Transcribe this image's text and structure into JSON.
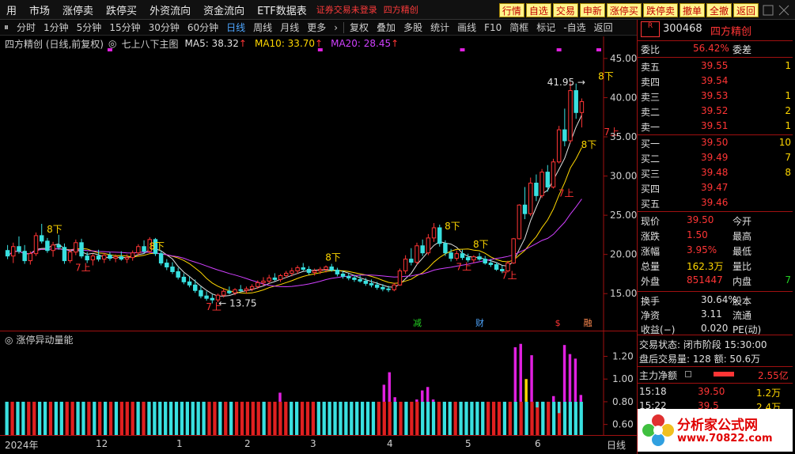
{
  "menu": {
    "items": [
      "用",
      "市场",
      "涨停卖",
      "跌停买",
      "外资流向",
      "资金流向",
      "ETF数据表"
    ],
    "warning": "证券交易未登录",
    "stock_name_tag": "四方精创",
    "quick_buttons": [
      "行情",
      "自选",
      "交易",
      "申新",
      "涨停买",
      "跌停卖",
      "撤单",
      "全撤"
    ],
    "back_label": "返回"
  },
  "toolbar": {
    "periods": [
      "分时",
      "1分钟",
      "5分钟",
      "15分钟",
      "30分钟",
      "60分钟",
      "日线",
      "周线",
      "月线",
      "更多"
    ],
    "active_period": "日线",
    "actions": [
      "复权",
      "叠加",
      "多股",
      "统计",
      "画线",
      "F10",
      "简框",
      "标记",
      "-自选",
      "返回"
    ]
  },
  "chart_header": {
    "title": "四方精创 (日线,前复权)",
    "indicator": "七上八下主图",
    "ma5": "MA5: 38.32",
    "ma10": "MA10: 33.70",
    "ma20": "MA20: 28.45",
    "ma5_color": "#e0e0e0",
    "ma10_color": "#ffd700",
    "ma20_color": "#d040ff"
  },
  "chart_data": [
    {
      "type": "candlestick",
      "title": "四方精创 (日线,前复权)",
      "ylim": [
        12.5,
        46
      ],
      "y_ticks": [
        15.0,
        20.0,
        25.0,
        30.0,
        35.0,
        40.0,
        45.0
      ],
      "x_labels": [
        "2024年",
        "12",
        "1",
        "2",
        "3",
        "4",
        "5",
        "6"
      ],
      "candles": [
        {
          "o": 20.5,
          "h": 21.2,
          "l": 19.4,
          "c": 19.8
        },
        {
          "o": 19.8,
          "h": 21.5,
          "l": 18.9,
          "c": 21.0
        },
        {
          "o": 21.0,
          "h": 22.3,
          "l": 20.1,
          "c": 20.4
        },
        {
          "o": 20.4,
          "h": 21.2,
          "l": 18.8,
          "c": 19.2
        },
        {
          "o": 19.2,
          "h": 20.4,
          "l": 18.7,
          "c": 20.1
        },
        {
          "o": 20.1,
          "h": 22.8,
          "l": 19.8,
          "c": 22.4
        },
        {
          "o": 22.4,
          "h": 23.9,
          "l": 21.4,
          "c": 21.7
        },
        {
          "o": 21.7,
          "h": 22.1,
          "l": 20.2,
          "c": 20.5
        },
        {
          "o": 20.5,
          "h": 21.6,
          "l": 19.7,
          "c": 21.2
        },
        {
          "o": 21.2,
          "h": 22.5,
          "l": 20.6,
          "c": 20.9
        },
        {
          "o": 20.9,
          "h": 21.4,
          "l": 18.8,
          "c": 19.2
        },
        {
          "o": 19.2,
          "h": 20.6,
          "l": 18.9,
          "c": 20.3
        },
        {
          "o": 20.3,
          "h": 21.9,
          "l": 19.9,
          "c": 21.5
        },
        {
          "o": 21.5,
          "h": 22.0,
          "l": 19.5,
          "c": 19.8
        },
        {
          "o": 19.8,
          "h": 20.3,
          "l": 18.9,
          "c": 19.3
        },
        {
          "o": 19.3,
          "h": 20.1,
          "l": 18.6,
          "c": 19.8
        },
        {
          "o": 19.8,
          "h": 20.6,
          "l": 19.1,
          "c": 19.4
        },
        {
          "o": 19.4,
          "h": 20.2,
          "l": 18.9,
          "c": 19.9
        },
        {
          "o": 19.9,
          "h": 20.3,
          "l": 19.2,
          "c": 19.5
        },
        {
          "o": 19.5,
          "h": 20.0,
          "l": 19.0,
          "c": 19.7
        },
        {
          "o": 19.7,
          "h": 20.4,
          "l": 19.2,
          "c": 19.4
        },
        {
          "o": 19.4,
          "h": 20.0,
          "l": 18.9,
          "c": 19.6
        },
        {
          "o": 19.6,
          "h": 20.5,
          "l": 19.2,
          "c": 20.2
        },
        {
          "o": 20.2,
          "h": 21.3,
          "l": 19.8,
          "c": 21.0
        },
        {
          "o": 21.0,
          "h": 21.8,
          "l": 20.1,
          "c": 20.4
        },
        {
          "o": 20.4,
          "h": 22.2,
          "l": 20.2,
          "c": 21.9
        },
        {
          "o": 21.9,
          "h": 22.1,
          "l": 19.8,
          "c": 20.1
        },
        {
          "o": 20.1,
          "h": 20.5,
          "l": 18.6,
          "c": 18.9
        },
        {
          "o": 18.9,
          "h": 19.4,
          "l": 18.0,
          "c": 18.4
        },
        {
          "o": 18.4,
          "h": 19.0,
          "l": 17.5,
          "c": 17.8
        },
        {
          "o": 17.8,
          "h": 18.3,
          "l": 16.8,
          "c": 17.1
        },
        {
          "o": 17.1,
          "h": 17.6,
          "l": 16.2,
          "c": 16.5
        },
        {
          "o": 16.5,
          "h": 17.2,
          "l": 15.8,
          "c": 16.1
        },
        {
          "o": 16.1,
          "h": 16.8,
          "l": 15.1,
          "c": 15.4
        },
        {
          "o": 15.4,
          "h": 15.9,
          "l": 14.4,
          "c": 14.7
        },
        {
          "o": 14.7,
          "h": 15.3,
          "l": 14.1,
          "c": 14.4
        },
        {
          "o": 14.4,
          "h": 14.9,
          "l": 13.75,
          "c": 14.2
        },
        {
          "o": 14.2,
          "h": 15.0,
          "l": 13.9,
          "c": 14.8
        },
        {
          "o": 14.8,
          "h": 15.6,
          "l": 14.5,
          "c": 15.3
        },
        {
          "o": 15.3,
          "h": 15.9,
          "l": 14.9,
          "c": 15.1
        },
        {
          "o": 15.1,
          "h": 15.7,
          "l": 14.8,
          "c": 15.5
        },
        {
          "o": 15.5,
          "h": 16.1,
          "l": 15.2,
          "c": 15.4
        },
        {
          "o": 15.4,
          "h": 15.9,
          "l": 15.0,
          "c": 15.6
        },
        {
          "o": 15.6,
          "h": 16.2,
          "l": 15.3,
          "c": 15.9
        },
        {
          "o": 15.9,
          "h": 16.7,
          "l": 15.6,
          "c": 16.4
        },
        {
          "o": 16.4,
          "h": 17.1,
          "l": 16.0,
          "c": 16.6
        },
        {
          "o": 16.6,
          "h": 17.4,
          "l": 16.3,
          "c": 17.0
        },
        {
          "o": 17.0,
          "h": 17.6,
          "l": 16.6,
          "c": 16.8
        },
        {
          "o": 16.8,
          "h": 17.5,
          "l": 16.5,
          "c": 17.3
        },
        {
          "o": 17.3,
          "h": 17.9,
          "l": 17.0,
          "c": 17.6
        },
        {
          "o": 17.6,
          "h": 18.3,
          "l": 17.2,
          "c": 17.9
        },
        {
          "o": 17.9,
          "h": 18.6,
          "l": 17.5,
          "c": 18.3
        },
        {
          "o": 18.3,
          "h": 18.9,
          "l": 17.9,
          "c": 18.1
        },
        {
          "o": 18.1,
          "h": 18.5,
          "l": 17.4,
          "c": 17.7
        },
        {
          "o": 17.7,
          "h": 18.2,
          "l": 17.3,
          "c": 17.9
        },
        {
          "o": 17.9,
          "h": 18.4,
          "l": 17.5,
          "c": 18.1
        },
        {
          "o": 18.1,
          "h": 18.6,
          "l": 17.7,
          "c": 18.4
        },
        {
          "o": 18.4,
          "h": 18.8,
          "l": 17.8,
          "c": 18.0
        },
        {
          "o": 18.0,
          "h": 18.3,
          "l": 17.2,
          "c": 17.5
        },
        {
          "o": 17.5,
          "h": 17.9,
          "l": 16.9,
          "c": 17.2
        },
        {
          "o": 17.2,
          "h": 17.6,
          "l": 16.7,
          "c": 17.0
        },
        {
          "o": 17.0,
          "h": 17.4,
          "l": 16.5,
          "c": 16.8
        },
        {
          "o": 16.8,
          "h": 17.3,
          "l": 16.4,
          "c": 16.6
        },
        {
          "o": 16.6,
          "h": 17.0,
          "l": 16.0,
          "c": 16.3
        },
        {
          "o": 16.3,
          "h": 16.8,
          "l": 15.8,
          "c": 16.1
        },
        {
          "o": 16.1,
          "h": 16.5,
          "l": 15.5,
          "c": 15.8
        },
        {
          "o": 15.8,
          "h": 16.2,
          "l": 15.3,
          "c": 15.6
        },
        {
          "o": 15.6,
          "h": 16.0,
          "l": 15.2,
          "c": 15.5
        },
        {
          "o": 15.5,
          "h": 16.4,
          "l": 15.3,
          "c": 16.1
        },
        {
          "o": 16.1,
          "h": 18.2,
          "l": 16.0,
          "c": 17.9
        },
        {
          "o": 17.9,
          "h": 19.9,
          "l": 17.5,
          "c": 19.4
        },
        {
          "o": 19.4,
          "h": 20.8,
          "l": 18.6,
          "c": 19.0
        },
        {
          "o": 19.0,
          "h": 21.5,
          "l": 18.7,
          "c": 21.1
        },
        {
          "o": 21.1,
          "h": 21.9,
          "l": 19.8,
          "c": 20.2
        },
        {
          "o": 20.2,
          "h": 22.6,
          "l": 19.9,
          "c": 22.1
        },
        {
          "o": 22.1,
          "h": 24.0,
          "l": 21.6,
          "c": 23.4
        },
        {
          "o": 23.4,
          "h": 23.8,
          "l": 21.0,
          "c": 21.4
        },
        {
          "o": 21.4,
          "h": 21.8,
          "l": 19.8,
          "c": 20.2
        },
        {
          "o": 20.2,
          "h": 20.7,
          "l": 19.1,
          "c": 19.5
        },
        {
          "o": 19.5,
          "h": 20.5,
          "l": 19.2,
          "c": 20.1
        },
        {
          "o": 20.1,
          "h": 20.6,
          "l": 19.3,
          "c": 19.6
        },
        {
          "o": 19.6,
          "h": 20.1,
          "l": 19.0,
          "c": 19.3
        },
        {
          "o": 19.3,
          "h": 19.9,
          "l": 18.9,
          "c": 19.7
        },
        {
          "o": 19.7,
          "h": 20.2,
          "l": 19.2,
          "c": 19.4
        },
        {
          "o": 19.4,
          "h": 19.8,
          "l": 18.7,
          "c": 18.9
        },
        {
          "o": 18.9,
          "h": 19.4,
          "l": 18.4,
          "c": 18.7
        },
        {
          "o": 18.7,
          "h": 19.0,
          "l": 17.9,
          "c": 18.1
        },
        {
          "o": 18.1,
          "h": 18.6,
          "l": 17.6,
          "c": 17.9
        },
        {
          "o": 17.9,
          "h": 19.2,
          "l": 17.7,
          "c": 18.9
        },
        {
          "o": 18.9,
          "h": 22.1,
          "l": 18.8,
          "c": 22.0
        },
        {
          "o": 22.0,
          "h": 26.4,
          "l": 21.9,
          "c": 26.3
        },
        {
          "o": 26.3,
          "h": 28.6,
          "l": 24.5,
          "c": 25.2
        },
        {
          "o": 25.2,
          "h": 29.8,
          "l": 24.9,
          "c": 29.1
        },
        {
          "o": 29.1,
          "h": 30.2,
          "l": 26.8,
          "c": 27.5
        },
        {
          "o": 27.5,
          "h": 30.9,
          "l": 27.2,
          "c": 30.5
        },
        {
          "o": 30.5,
          "h": 31.4,
          "l": 28.0,
          "c": 28.6
        },
        {
          "o": 28.6,
          "h": 32.2,
          "l": 28.4,
          "c": 31.8
        },
        {
          "o": 31.8,
          "h": 36.4,
          "l": 31.6,
          "c": 35.9
        },
        {
          "o": 35.9,
          "h": 38.6,
          "l": 33.8,
          "c": 34.5
        },
        {
          "o": 34.5,
          "h": 41.95,
          "l": 34.2,
          "c": 40.9
        },
        {
          "o": 40.9,
          "h": 41.8,
          "l": 37.3,
          "c": 38.1
        },
        {
          "o": 38.1,
          "h": 39.9,
          "l": 36.2,
          "c": 39.5
        }
      ],
      "annotations": [
        {
          "text": "8下",
          "x": 8,
          "y": 22.8,
          "color": "#ffd700"
        },
        {
          "text": "7上",
          "x": 13,
          "y": 17.9,
          "color": "#ff3535"
        },
        {
          "text": "8下",
          "x": 26,
          "y": 20.6,
          "color": "#ffd700"
        },
        {
          "text": "7上",
          "x": 36,
          "y": 12.9,
          "color": "#ff3535"
        },
        {
          "text": "8下",
          "x": 57,
          "y": 19.2,
          "color": "#ffd700"
        },
        {
          "text": "8下",
          "x": 78,
          "y": 23.2,
          "color": "#ffd700"
        },
        {
          "text": "8下",
          "x": 83,
          "y": 20.9,
          "color": "#ffd700"
        },
        {
          "text": "7上",
          "x": 80,
          "y": 18.0,
          "color": "#ff3535"
        },
        {
          "text": "7上",
          "x": 88,
          "y": 16.9,
          "color": "#ff3535"
        },
        {
          "text": "7上",
          "x": 98,
          "y": 27.4,
          "color": "#ff3535"
        },
        {
          "text": "8下",
          "x": 102,
          "y": 33.6,
          "color": "#ffd700"
        },
        {
          "text": "8下",
          "x": 105,
          "y": 42.3,
          "color": "#ffd700"
        },
        {
          "text": "7上",
          "x": 106,
          "y": 35.2,
          "color": "#ff3535"
        }
      ],
      "price_labels": [
        {
          "text": "41.95",
          "x": 103,
          "y": 41.95
        },
        {
          "text": "13.75",
          "x": 36,
          "y": 13.75
        }
      ],
      "event_tags": [
        {
          "text": "减",
          "x": 72,
          "color": "#22d022"
        },
        {
          "text": "财",
          "x": 83,
          "color": "#4ea6ff"
        },
        {
          "text": "$",
          "x": 97,
          "color": "#ff3535"
        },
        {
          "text": "融",
          "x": 102,
          "color": "#ff8a50"
        }
      ],
      "magenta_marks_x": [
        18,
        55,
        80,
        97,
        104
      ]
    },
    {
      "type": "bar",
      "title": "涨停异动量能",
      "ylim": [
        0.5,
        1.35
      ],
      "y_ticks": [
        0.6,
        0.8,
        1.0,
        1.2
      ],
      "note": "bars below 0.8 = base bars (red/cyan); above = magenta signal bars",
      "values": [
        0.8,
        0.8,
        0.8,
        0.8,
        0.8,
        0.8,
        0.8,
        0.8,
        0.8,
        0.8,
        0.8,
        0.8,
        0.8,
        0.8,
        0.8,
        0.8,
        0.8,
        0.8,
        0.8,
        0.8,
        0.8,
        0.8,
        0.8,
        0.8,
        0.8,
        0.8,
        0.8,
        0.8,
        0.8,
        0.8,
        0.8,
        0.8,
        0.8,
        0.8,
        0.8,
        0.8,
        0.8,
        0.8,
        0.8,
        0.8,
        0.8,
        0.8,
        0.8,
        0.8,
        0.8,
        0.8,
        0.8,
        0.8,
        0.8,
        0.8,
        0.88,
        0.8,
        0.8,
        0.8,
        0.8,
        0.8,
        0.8,
        0.8,
        0.8,
        0.8,
        0.8,
        0.8,
        0.8,
        0.8,
        0.8,
        0.8,
        0.8,
        0.8,
        0.8,
        0.95,
        1.06,
        0.84,
        0.8,
        0.8,
        0.8,
        0.82,
        0.9,
        0.93,
        0.82,
        0.8,
        0.8,
        0.8,
        0.8,
        0.8,
        0.8,
        0.8,
        0.8,
        0.8,
        0.8,
        0.8,
        0.8,
        0.8,
        0.8,
        1.28,
        1.31,
        1.0,
        1.21,
        0.75,
        0.74,
        0.8,
        0.85,
        0.7,
        1.3,
        1.22,
        1.18,
        0.86
      ],
      "signal_color": "#e020e0",
      "yellow_index": 95
    }
  ],
  "volume_panel": {
    "title": "涨停异动量能"
  },
  "x_axis": {
    "labels": [
      "2024年",
      "12",
      "1",
      "2",
      "3",
      "4",
      "5",
      "6"
    ],
    "right_label": "日线"
  },
  "right_panel": {
    "code": "300468",
    "name": "四方精创",
    "market_icon": "R",
    "weibi_label": "委比",
    "weibi_value": "56.42%",
    "weicha_label": "委差",
    "asks": [
      {
        "label": "卖五",
        "price": "39.55",
        "vol": "1"
      },
      {
        "label": "卖四",
        "price": "39.54",
        "vol": ""
      },
      {
        "label": "卖三",
        "price": "39.53",
        "vol": "1"
      },
      {
        "label": "卖二",
        "price": "39.52",
        "vol": "2"
      },
      {
        "label": "卖一",
        "price": "39.51",
        "vol": "1"
      }
    ],
    "bids": [
      {
        "label": "买一",
        "price": "39.50",
        "vol": "10"
      },
      {
        "label": "买二",
        "price": "39.49",
        "vol": "7"
      },
      {
        "label": "买三",
        "price": "39.48",
        "vol": "8"
      },
      {
        "label": "买四",
        "price": "39.47",
        "vol": ""
      },
      {
        "label": "买五",
        "price": "39.46",
        "vol": ""
      }
    ],
    "quote": [
      {
        "l1": "现价",
        "v1": "39.50",
        "l2": "今开",
        "v2": "",
        "c1": "red"
      },
      {
        "l1": "涨跌",
        "v1": "1.50",
        "l2": "最高",
        "v2": "",
        "c1": "red"
      },
      {
        "l1": "涨幅",
        "v1": "3.95%",
        "l2": "最低",
        "v2": "",
        "c1": "red"
      },
      {
        "l1": "总量",
        "v1": "162.3万",
        "l2": "量比",
        "v2": "",
        "c1": "yellow"
      },
      {
        "l1": "外盘",
        "v1": "851447",
        "l2": "内盘",
        "v2": "7",
        "c1": "red"
      }
    ],
    "stats": [
      {
        "l1": "换手",
        "v1": "30.64%",
        "l2": "股本"
      },
      {
        "l1": "净资",
        "v1": "3.11",
        "l2": "流通"
      },
      {
        "l1": "收益(−)",
        "v1": "0.020",
        "l2": "PE(动)"
      }
    ],
    "trade_status": "交易状态: 闭市阶段 15:30:00",
    "after_hours": "盘后交易量: 128  额: 50.6万",
    "main_flow_label": "主力净额",
    "main_flow_value": "2.55亿",
    "ticks": [
      {
        "time": "15:18",
        "price": "39.50",
        "vol": "1.2万"
      },
      {
        "time": "15:22",
        "price": "39.5",
        "vol": "2.4万"
      }
    ],
    "watermark": "分析家公式网",
    "watermark_url": "www.70822.com"
  }
}
